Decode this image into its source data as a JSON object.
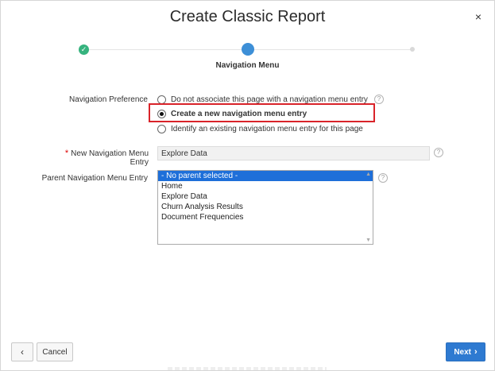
{
  "dialog": {
    "title": "Create Classic Report",
    "close_glyph": "×"
  },
  "wizard": {
    "done_glyph": "✓",
    "current_step_label": "Navigation Menu"
  },
  "form": {
    "nav_pref": {
      "label": "Navigation Preference",
      "options": [
        {
          "label": "Do not associate this page with a navigation menu entry",
          "checked": false
        },
        {
          "label": "Create a new navigation menu entry",
          "checked": true
        },
        {
          "label": "Identify an existing navigation menu entry for this page",
          "checked": false
        }
      ]
    },
    "new_entry": {
      "required_mark": "*",
      "label": "New Navigation Menu Entry",
      "value": "Explore Data"
    },
    "parent_entry": {
      "label": "Parent Navigation Menu Entry",
      "items": [
        "- No parent selected -",
        "Home",
        "Explore Data",
        "Churn Analysis Results",
        "Document Frequencies"
      ],
      "selected_index": 0
    },
    "help_glyph": "?"
  },
  "footer": {
    "back_glyph": "‹",
    "cancel_label": "Cancel",
    "next_label": "Next",
    "next_glyph": "›"
  },
  "icons": {
    "close": "close-icon",
    "help": "help-icon",
    "back": "chevron-left-icon",
    "next": "chevron-right-icon",
    "check": "check-icon"
  },
  "colors": {
    "primary": "#2e7ad1",
    "step_done": "#36b37e",
    "step_current": "#3d8fd7",
    "highlight": "#d9232a",
    "selected": "#1e6fd9"
  }
}
